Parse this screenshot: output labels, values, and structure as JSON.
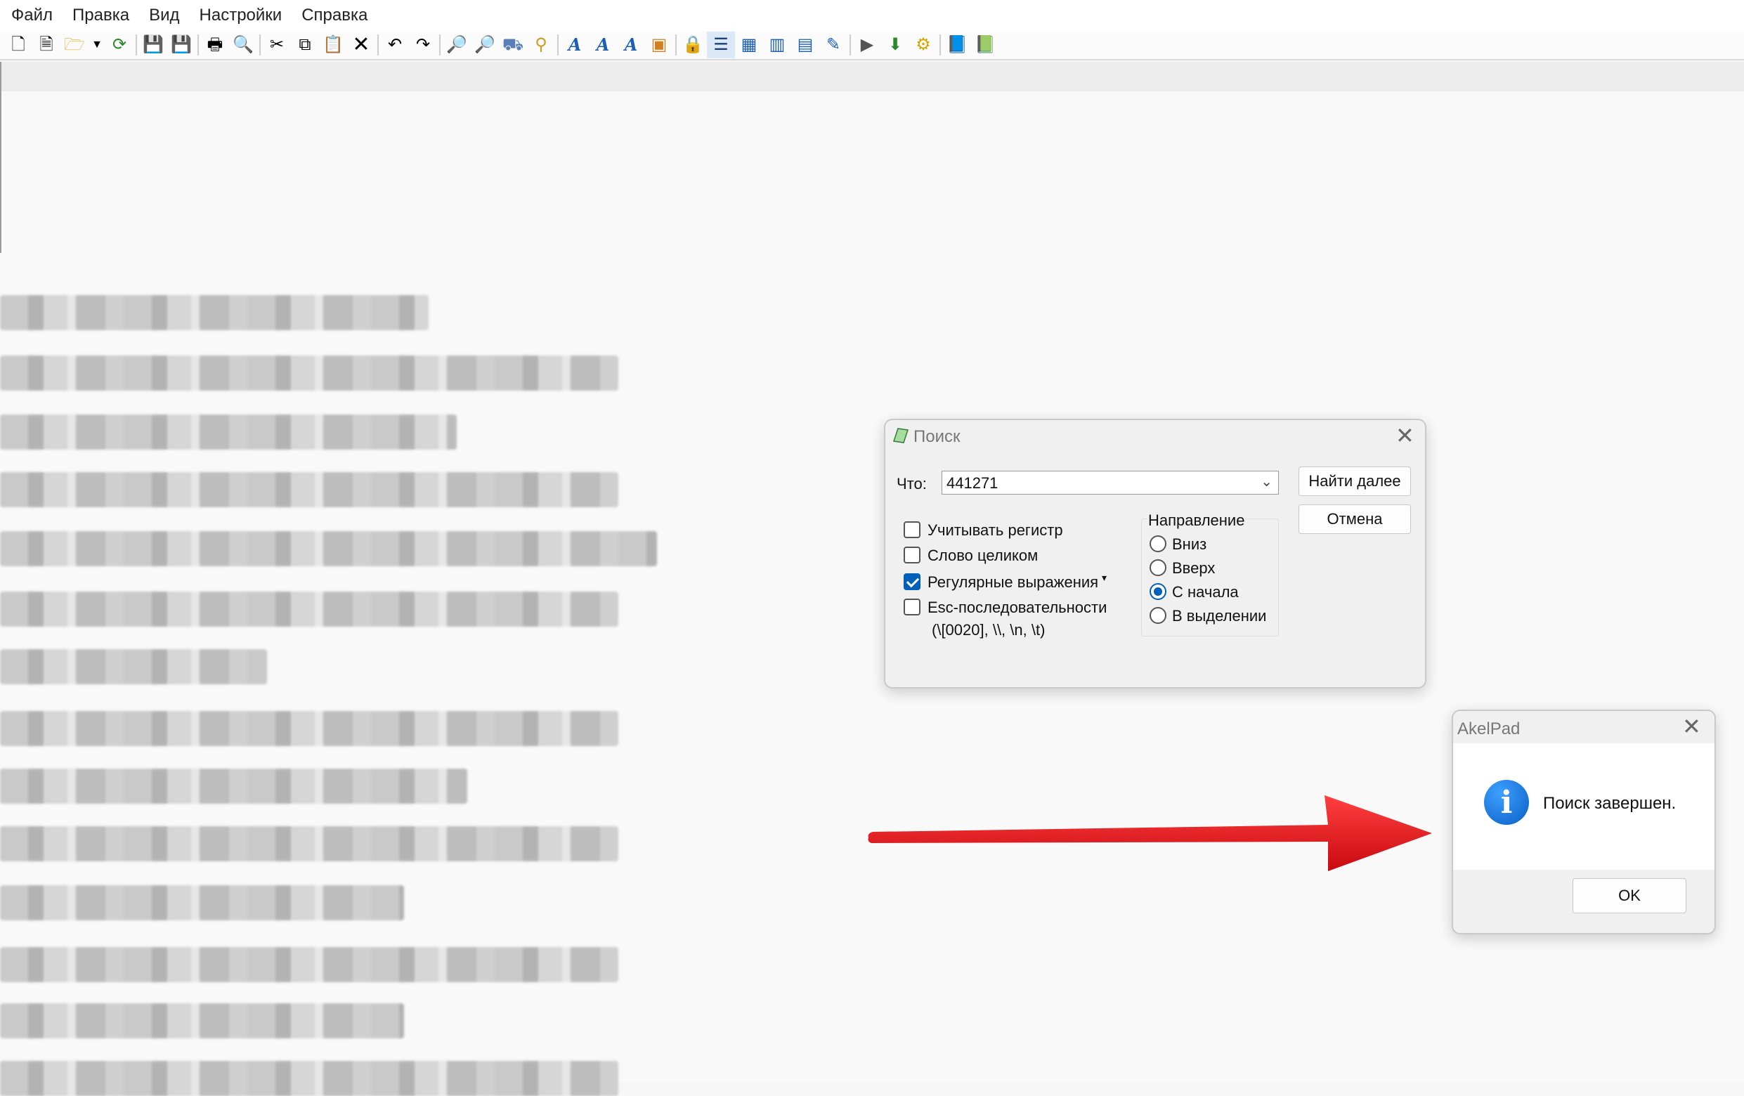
{
  "menu": [
    "Файл",
    "Правка",
    "Вид",
    "Настройки",
    "Справка"
  ],
  "toolbar": {
    "icons": [
      "new-file-icon",
      "new-window-icon",
      "open-folder-icon",
      "dropdown-arrow-icon",
      "reopen-icon",
      "save-icon",
      "save-all-icon",
      "print-icon",
      "print-preview-icon",
      "cut-icon",
      "copy-icon",
      "paste-icon",
      "delete-icon",
      "undo-icon",
      "redo-icon",
      "find-icon",
      "find-next-icon",
      "replace-icon",
      "goto-icon",
      "font-icon",
      "font-increase-icon",
      "font-decrease-icon",
      "color-icon",
      "lock-icon",
      "word-wrap-icon",
      "split-window-icon",
      "split-horizontal-icon",
      "split-vertical-icon",
      "pin-icon",
      "run-icon",
      "plugin-icon",
      "settings-gear-icon",
      "help-book-icon",
      "akelpad-icon"
    ]
  },
  "find_dialog": {
    "title": "Поиск",
    "what_label": "Что:",
    "what_value": "441271",
    "find_next": "Найти далее",
    "cancel": "Отмена",
    "options": [
      {
        "label": "Учитывать регистр",
        "checked": false
      },
      {
        "label": "Слово целиком",
        "checked": false
      },
      {
        "label": "Регулярные выражения",
        "checked": true
      },
      {
        "label": "Esc-последовательности",
        "checked": false
      }
    ],
    "esc_hint": "(\\[0020], \\\\, \\n, \\t)",
    "direction_label": "Направление",
    "directions": [
      {
        "label": "Вниз",
        "selected": false
      },
      {
        "label": "Вверх",
        "selected": false
      },
      {
        "label": "С начала",
        "selected": true
      },
      {
        "label": "В выделении",
        "selected": false
      }
    ]
  },
  "message_box": {
    "title": "AkelPad",
    "text": "Поиск завершен.",
    "ok": "OK"
  },
  "colors": {
    "accent": "#005fb8",
    "arrow": "#e8141b"
  }
}
